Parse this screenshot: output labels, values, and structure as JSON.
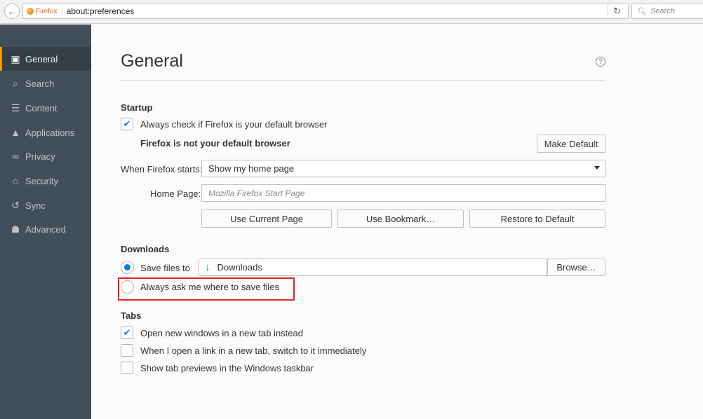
{
  "browser": {
    "brand": "Firefox",
    "url": "about:preferences",
    "search_placeholder": "Search"
  },
  "sidebar": {
    "items": [
      {
        "label": "General",
        "icon": "general-icon",
        "selected": true
      },
      {
        "label": "Search",
        "icon": "search-icon",
        "selected": false
      },
      {
        "label": "Content",
        "icon": "content-icon",
        "selected": false
      },
      {
        "label": "Applications",
        "icon": "applications-icon",
        "selected": false
      },
      {
        "label": "Privacy",
        "icon": "privacy-icon",
        "selected": false
      },
      {
        "label": "Security",
        "icon": "security-icon",
        "selected": false
      },
      {
        "label": "Sync",
        "icon": "sync-icon",
        "selected": false
      },
      {
        "label": "Advanced",
        "icon": "advanced-icon",
        "selected": false
      }
    ]
  },
  "page": {
    "title": "General"
  },
  "startup": {
    "heading": "Startup",
    "default_check_label": "Always check if Firefox is your default browser",
    "default_check_checked": true,
    "not_default_text": "Firefox is not your default browser",
    "make_default_label": "Make Default",
    "when_starts_label": "When Firefox starts:",
    "when_starts_value": "Show my home page",
    "home_page_label": "Home Page:",
    "home_page_placeholder": "Mozilla Firefox Start Page",
    "use_current_label": "Use Current Page",
    "use_bookmark_label": "Use Bookmark…",
    "restore_default_label": "Restore to Default"
  },
  "downloads": {
    "heading": "Downloads",
    "save_files_label": "Save files to",
    "save_files_selected": true,
    "folder": "Downloads",
    "browse_label": "Browse…",
    "always_ask_label": "Always ask me where to save files",
    "always_ask_selected": false
  },
  "tabs": {
    "heading": "Tabs",
    "items": [
      {
        "label": "Open new windows in a new tab instead",
        "checked": true
      },
      {
        "label": "When I open a link in a new tab, switch to it immediately",
        "checked": false
      },
      {
        "label": "Show tab previews in the Windows taskbar",
        "checked": false
      }
    ]
  },
  "colors": {
    "sidebar_bg": "#424f5a",
    "selected_accent": "#ff9500",
    "check_blue": "#0b7bd6",
    "highlight_red": "#e1251b"
  }
}
